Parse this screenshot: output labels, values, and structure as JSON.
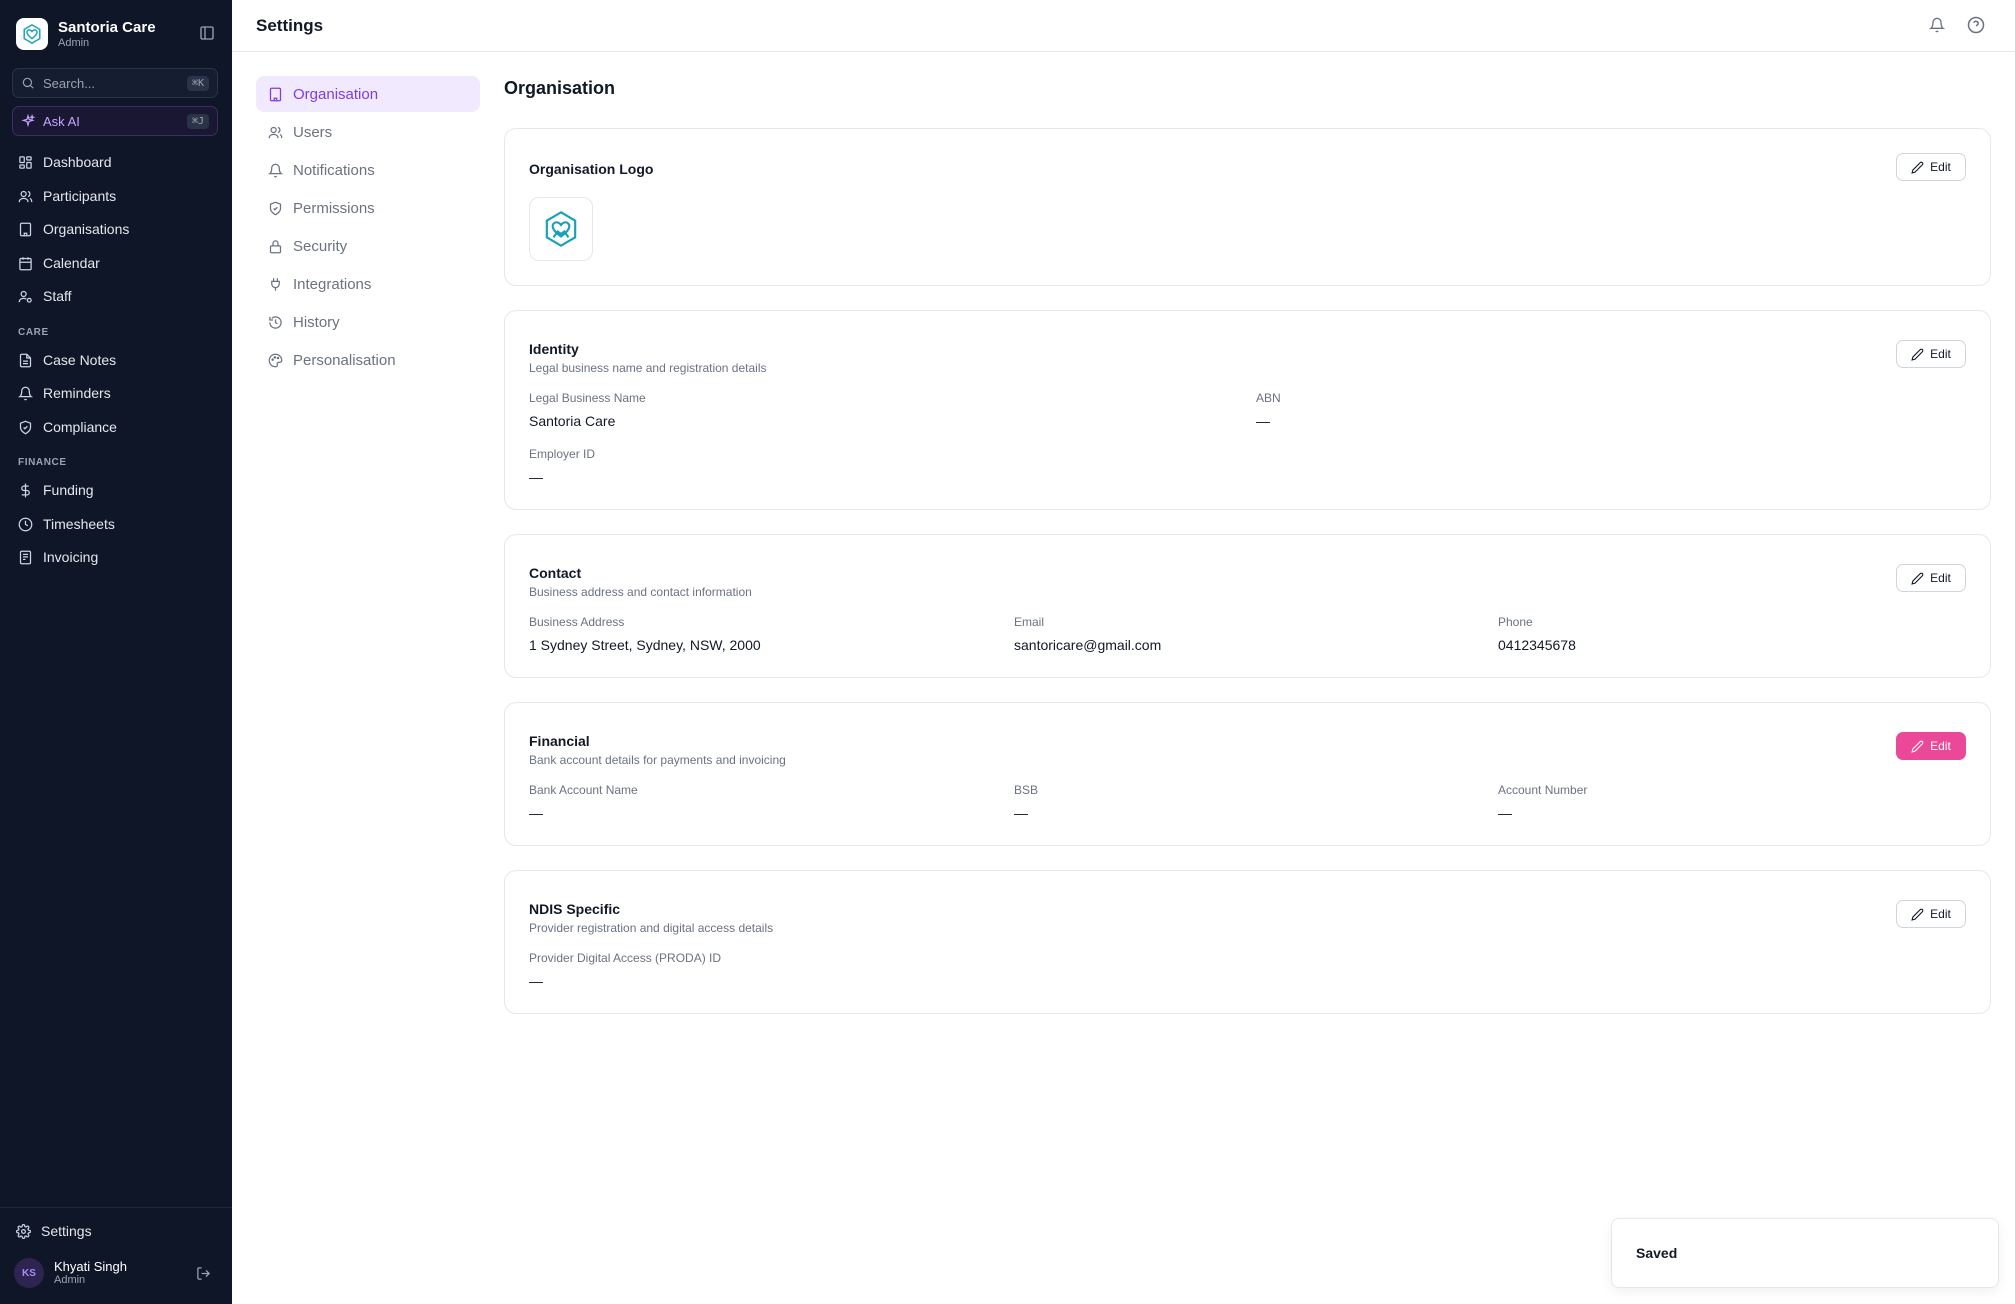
{
  "brand": {
    "name": "Santoria Care",
    "role": "Admin"
  },
  "sidebar": {
    "search_placeholder": "Search...",
    "search_shortcut": "⌘K",
    "ask_ai_label": "Ask AI",
    "ask_ai_shortcut": "⌘J",
    "main_items": [
      {
        "label": "Dashboard",
        "icon": "grid-icon"
      },
      {
        "label": "Participants",
        "icon": "users-icon"
      },
      {
        "label": "Organisations",
        "icon": "building-icon"
      },
      {
        "label": "Calendar",
        "icon": "calendar-icon"
      },
      {
        "label": "Staff",
        "icon": "user-cog-icon"
      }
    ],
    "care_label": "CARE",
    "care_items": [
      {
        "label": "Case Notes",
        "icon": "file-icon"
      },
      {
        "label": "Reminders",
        "icon": "bell-icon"
      },
      {
        "label": "Compliance",
        "icon": "shield-icon"
      }
    ],
    "finance_label": "FINANCE",
    "finance_items": [
      {
        "label": "Funding",
        "icon": "dollar-icon"
      },
      {
        "label": "Timesheets",
        "icon": "clock-icon"
      },
      {
        "label": "Invoicing",
        "icon": "receipt-icon"
      }
    ],
    "settings_label": "Settings",
    "user": {
      "initials": "KS",
      "name": "Khyati Singh",
      "role": "Admin"
    }
  },
  "header": {
    "title": "Settings"
  },
  "settings_nav": [
    {
      "label": "Organisation",
      "icon": "building-icon",
      "active": true
    },
    {
      "label": "Users",
      "icon": "users-icon"
    },
    {
      "label": "Notifications",
      "icon": "bell-icon"
    },
    {
      "label": "Permissions",
      "icon": "shield-icon"
    },
    {
      "label": "Security",
      "icon": "lock-icon"
    },
    {
      "label": "Integrations",
      "icon": "plug-icon"
    },
    {
      "label": "History",
      "icon": "history-icon"
    },
    {
      "label": "Personalisation",
      "icon": "palette-icon"
    }
  ],
  "content": {
    "title": "Organisation",
    "edit_label": "Edit",
    "logo_card": {
      "title": "Organisation Logo"
    },
    "identity": {
      "title": "Identity",
      "subtitle": "Legal business name and registration details",
      "legal_name_label": "Legal Business Name",
      "legal_name_value": "Santoria Care",
      "abn_label": "ABN",
      "abn_value": "—",
      "employer_id_label": "Employer ID",
      "employer_id_value": "—"
    },
    "contact": {
      "title": "Contact",
      "subtitle": "Business address and contact information",
      "address_label": "Business Address",
      "address_value": "1 Sydney Street, Sydney, NSW, 2000",
      "email_label": "Email",
      "email_value": "santoricare@gmail.com",
      "phone_label": "Phone",
      "phone_value": "0412345678"
    },
    "financial": {
      "title": "Financial",
      "subtitle": "Bank account details for payments and invoicing",
      "bank_name_label": "Bank Account Name",
      "bank_name_value": "—",
      "bsb_label": "BSB",
      "bsb_value": "—",
      "account_label": "Account Number",
      "account_value": "—"
    },
    "ndis": {
      "title": "NDIS Specific",
      "subtitle": "Provider registration and digital access details",
      "proda_label": "Provider Digital Access (PRODA) ID",
      "proda_value": "—"
    }
  },
  "toast": {
    "text": "Saved"
  },
  "colors": {
    "accent": "#7c3aed",
    "highlight": "#ec4899",
    "sidebar_bg": "#0f1628",
    "logo_teal": "#17a2b8"
  }
}
